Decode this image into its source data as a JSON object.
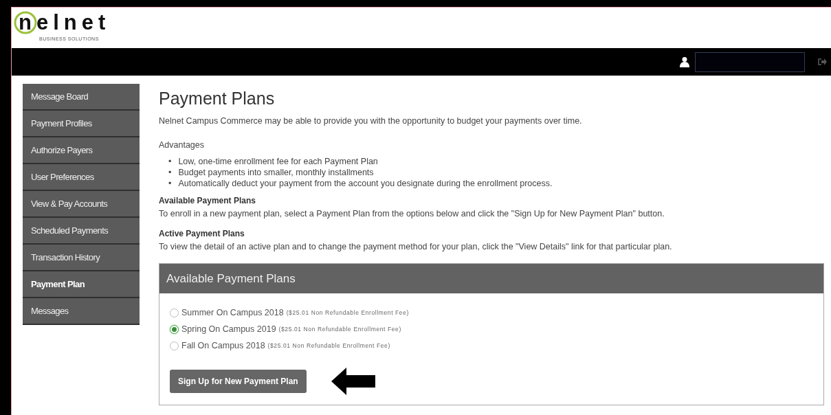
{
  "logo": {
    "name": "nelnet",
    "tagline": "BUSINESS SOLUTIONS"
  },
  "sidebar": {
    "items": [
      {
        "label": "Message Board",
        "selected": false
      },
      {
        "label": "Payment Profiles",
        "selected": false
      },
      {
        "label": "Authorize Payers",
        "selected": false
      },
      {
        "label": "User Preferences",
        "selected": false
      },
      {
        "label": "View & Pay Accounts",
        "selected": false
      },
      {
        "label": "Scheduled Payments",
        "selected": false
      },
      {
        "label": "Transaction History",
        "selected": false
      },
      {
        "label": "Payment Plan",
        "selected": true
      },
      {
        "label": "Messages",
        "selected": false
      }
    ]
  },
  "page": {
    "title": "Payment Plans",
    "intro": "Nelnet Campus Commerce may be able to provide you with the opportunity to budget your payments over time.",
    "advantages_heading": "Advantages",
    "advantages": [
      {
        "marker": "•",
        "text": "Low, one-time enrollment fee for each Payment Plan"
      },
      {
        "marker": "•",
        "text": "Budget payments into smaller, monthly installments"
      },
      {
        "marker": "•",
        "text": "Automatically deduct your payment from the account you designate during the enrollment process."
      }
    ],
    "sections": [
      {
        "heading": "Available Payment Plans",
        "text": "To enroll in a new payment plan, select a Payment Plan from the options below and click the \"Sign Up for New Payment Plan\" button."
      },
      {
        "heading": "Active Payment Plans",
        "text": "To view the detail of an active plan and to change the payment method for your plan, click the \"View Details\" link for that particular plan."
      }
    ]
  },
  "panel": {
    "title": "Available Payment Plans",
    "options": [
      {
        "label": "Summer On Campus 2018",
        "fee": "($25.01 Non Refundable Enrollment Fee)",
        "selected": false
      },
      {
        "label": "Spring On Campus 2019",
        "fee": "($25.01 Non Refundable Enrollment Fee)",
        "selected": true
      },
      {
        "label": "Fall On Campus 2018",
        "fee": "($25.01 Non Refundable Enrollment Fee)",
        "selected": false
      }
    ],
    "button": "Sign Up for New Payment Plan"
  }
}
